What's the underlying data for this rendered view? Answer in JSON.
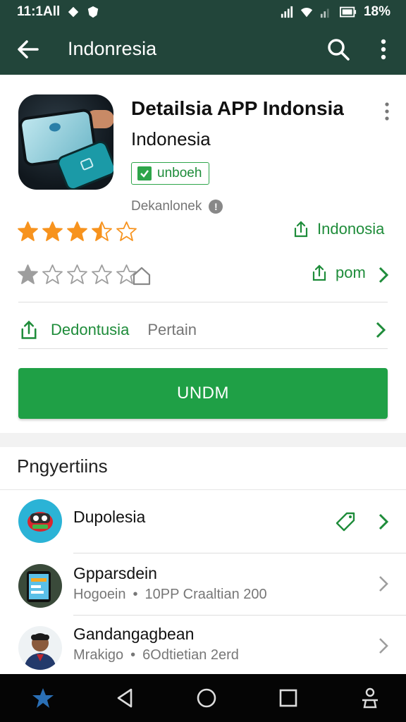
{
  "status_bar": {
    "time": "11:1All",
    "battery": "18%"
  },
  "toolbar": {
    "title": "Indonresia",
    "back_icon": "arrow-back-icon",
    "search_icon": "search-icon",
    "more_icon": "more-vert-icon"
  },
  "app": {
    "title": "Detailsia APP Indonsia",
    "subtitle": "Indonesia",
    "badge": "unboeh",
    "developer": "Dekanlonek",
    "rating_1": 3.5,
    "rating_2": 1,
    "link_1": "Indonosia",
    "link_2": "pom",
    "row3_link": "Dedontusia",
    "row3_meta": "Pertain",
    "install_label": "UNDM"
  },
  "section": {
    "title": "Pngyertiins",
    "items": [
      {
        "name": "Dupolesia",
        "sub": "",
        "meta": "",
        "tag_icon": "tag-icon"
      },
      {
        "name": "Gpparsdein",
        "sub": "Hogoein",
        "meta": "10PP Craaltian 200"
      },
      {
        "name": "Gandangagbean",
        "sub": "Mrakigo",
        "meta": "6Odtietian 2erd"
      }
    ]
  },
  "colors": {
    "toolbar": "#22453a",
    "accent": "#1fa046",
    "star_filled": "#f7931e",
    "star_empty": "#9e9e9e"
  }
}
